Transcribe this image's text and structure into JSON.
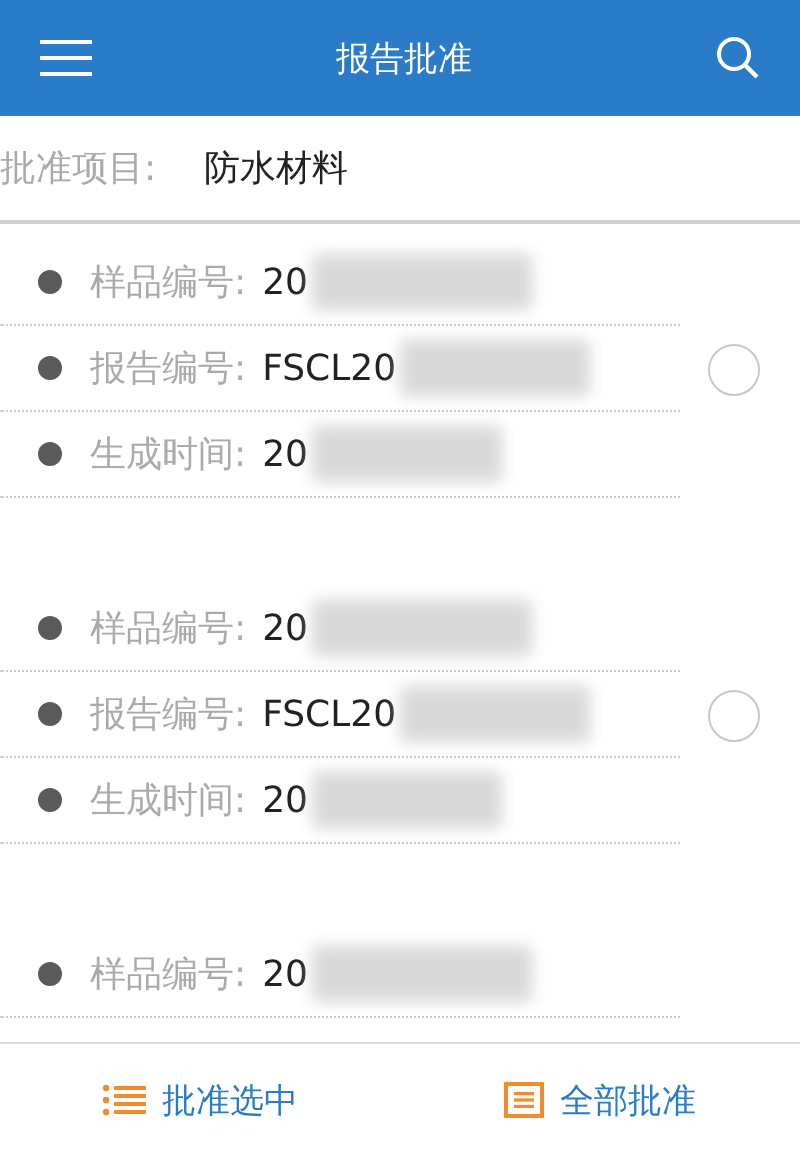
{
  "header": {
    "title": "报告批准"
  },
  "project": {
    "label": "批准项目:",
    "value": "防水材料"
  },
  "reports": [
    {
      "selected": false,
      "fields": [
        {
          "label": "样品编号:",
          "value": "20"
        },
        {
          "label": "报告编号:",
          "value": "FSCL20"
        },
        {
          "label": "生成时间:",
          "value": "20"
        }
      ]
    },
    {
      "selected": false,
      "fields": [
        {
          "label": "样品编号:",
          "value": "20"
        },
        {
          "label": "报告编号:",
          "value": "FSCL20"
        },
        {
          "label": "生成时间:",
          "value": "20"
        }
      ]
    },
    {
      "fields": [
        {
          "label": "样品编号:",
          "value": "20"
        }
      ]
    }
  ],
  "actions": [
    {
      "kind": "list",
      "label": "批准选中"
    },
    {
      "kind": "doc",
      "label": "全部批准"
    }
  ]
}
